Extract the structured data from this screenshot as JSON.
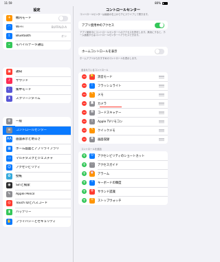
{
  "status": {
    "time": "11:59",
    "battery": "80%"
  },
  "sidebar": {
    "title": "設定",
    "groups": [
      [
        {
          "label": "機内モード",
          "icon": "airplane-icon",
          "color": "#ff9500",
          "glyph": "✈",
          "accessory": "toggle"
        },
        {
          "label": "Wi-Fi",
          "icon": "wifi-icon",
          "color": "#0a7aff",
          "glyph": "◠",
          "value": "BUFFALO-A"
        },
        {
          "label": "Bluetooth",
          "icon": "bluetooth-icon",
          "color": "#0a7aff",
          "glyph": "ᛒ",
          "value": "オン"
        },
        {
          "label": "モバイルデータ通信",
          "icon": "antenna-icon",
          "color": "#34c759",
          "glyph": "⌁"
        }
      ],
      [
        {
          "label": "通知",
          "icon": "notifications-icon",
          "color": "#ff3b30",
          "glyph": "▣"
        },
        {
          "label": "サウンド",
          "icon": "sound-icon",
          "color": "#ff2d55",
          "glyph": "♪"
        },
        {
          "label": "集中モード",
          "icon": "moon-icon",
          "color": "#5856d6",
          "glyph": "☾"
        },
        {
          "label": "スクリーンタイム",
          "icon": "hourglass-icon",
          "color": "#5856d6",
          "glyph": "⧗"
        }
      ],
      [
        {
          "label": "一般",
          "icon": "gear-icon",
          "color": "#8e8e93",
          "glyph": "⚙"
        },
        {
          "label": "コントロールセンター",
          "icon": "control-center-icon",
          "color": "#8e8e93",
          "glyph": "≡",
          "selected": true
        },
        {
          "label": "画面表示と明るさ",
          "icon": "brightness-icon",
          "color": "#0a7aff",
          "glyph": "AA"
        },
        {
          "label": "ホーム画面とアプリライブラリ",
          "icon": "home-screen-icon",
          "color": "#0a7aff",
          "glyph": "▦",
          "two": true
        },
        {
          "label": "マルチタスクとジェスチャ",
          "icon": "multitask-icon",
          "color": "#0a7aff",
          "glyph": "▭"
        },
        {
          "label": "アクセシビリティ",
          "icon": "accessibility-icon",
          "color": "#0a7aff",
          "glyph": "☺"
        },
        {
          "label": "壁紙",
          "icon": "wallpaper-icon",
          "color": "#34aadc",
          "glyph": "✿"
        },
        {
          "label": "Siriと検索",
          "icon": "siri-icon",
          "color": "#2c2c2e",
          "glyph": "◉"
        },
        {
          "label": "Apple Pencil",
          "icon": "pencil-icon",
          "color": "#8e8e93",
          "glyph": "✎"
        },
        {
          "label": "Touch IDとパスコード",
          "icon": "fingerprint-icon",
          "color": "#ff3b30",
          "glyph": "◎"
        },
        {
          "label": "バッテリー",
          "icon": "battery-icon",
          "color": "#34c759",
          "glyph": "▮"
        },
        {
          "label": "プライバシーとセキュリティ",
          "icon": "hand-icon",
          "color": "#0a7aff",
          "glyph": "✋",
          "two": true
        }
      ]
    ]
  },
  "main": {
    "title": "コントロールセンター",
    "intro": "コントロールセンターは画面の右上から下にスワイプして開きます。",
    "access_label": "アプリ使用中のアクセス",
    "access_desc": "アプリ使用中にコントロールセンターへのアクセスを許可します。無効にすると、ホーム画面からはコントロールセンターへアクセスできます。",
    "home_label": "ホームコントロールを表示",
    "home_desc": "ホームアプリからおすすめのコントロールを表示します。",
    "included_header": "含まれているコントロール",
    "included": [
      {
        "label": "消音モード",
        "icon": "bell-icon",
        "color": "#ff3b30",
        "glyph": "🔔"
      },
      {
        "label": "フラッシュライト",
        "icon": "flashlight-icon",
        "color": "#0a7aff",
        "glyph": "❘"
      },
      {
        "label": "メモ",
        "icon": "notes-icon",
        "color": "#ff9500",
        "glyph": "✎"
      },
      {
        "label": "カメラ",
        "icon": "camera-icon",
        "color": "#8e8e93",
        "glyph": "◙"
      },
      {
        "label": "コードスキャナー",
        "icon": "qr-code-icon",
        "color": "#8e8e93",
        "glyph": "▦"
      },
      {
        "label": "Apple TVリモコン",
        "icon": "remote-icon",
        "color": "#8e8e93",
        "glyph": "▯"
      },
      {
        "label": "クイックメモ",
        "icon": "quick-note-icon",
        "color": "#ff9500",
        "glyph": "✎"
      },
      {
        "label": "画面収録",
        "icon": "record-icon",
        "color": "#8e8e93",
        "glyph": "◉"
      }
    ],
    "more_header": "コントロールを追加",
    "more": [
      {
        "label": "アクセシビリティのショートカット",
        "icon": "accessibility-shortcut-icon",
        "color": "#0a7aff",
        "glyph": "☺"
      },
      {
        "label": "アクセスガイド",
        "icon": "guided-access-icon",
        "color": "#8e8e93",
        "glyph": "◌"
      },
      {
        "label": "アラーム",
        "icon": "alarm-icon",
        "color": "#ff9500",
        "glyph": "⏰"
      },
      {
        "label": "キーボードの輝度",
        "icon": "keyboard-brightness-icon",
        "color": "#0a7aff",
        "glyph": "☼"
      },
      {
        "label": "サウンド認識",
        "icon": "sound-recognition-icon",
        "color": "#ff3b30",
        "glyph": "◍"
      },
      {
        "label": "ストップウォッチ",
        "icon": "stopwatch-icon",
        "color": "#ff9500",
        "glyph": "⏱"
      }
    ]
  }
}
